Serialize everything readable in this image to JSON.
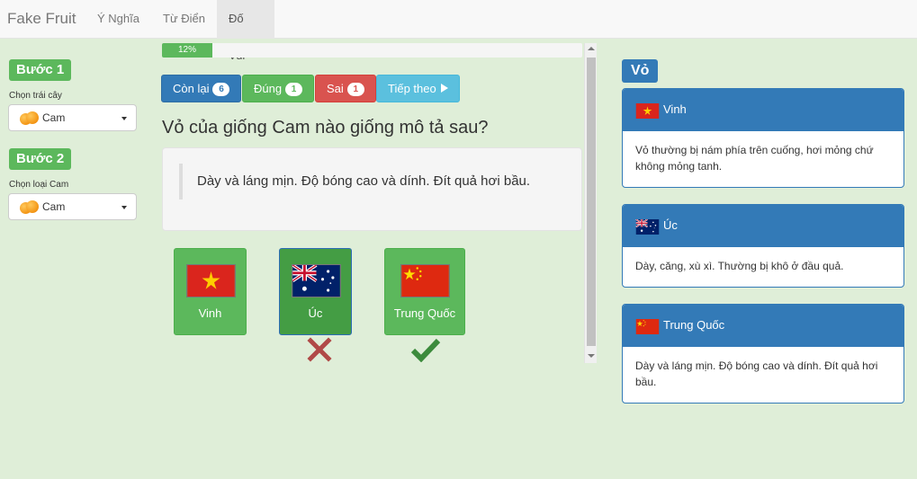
{
  "navbar": {
    "brand": "Fake Fruit",
    "items": [
      {
        "label": "Ý Nghĩa",
        "active": false
      },
      {
        "label": "Từ Điển",
        "active": false
      },
      {
        "label": "Đố Vui",
        "active": true
      }
    ]
  },
  "sidebar": {
    "step1": {
      "title": "Bước 1",
      "label": "Chọn trái cây",
      "value": "Cam",
      "icon": "orange-icon"
    },
    "step2": {
      "title": "Bước 2",
      "label": "Chọn loại Cam",
      "value": "Cam",
      "icon": "orange-icon"
    }
  },
  "quiz": {
    "progress": {
      "percent": 12,
      "label": "12%"
    },
    "buttons": {
      "remaining": {
        "label": "Còn lại",
        "count": "6"
      },
      "correct": {
        "label": "Đúng",
        "count": "1"
      },
      "wrong": {
        "label": "Sai",
        "count": "1"
      },
      "next": {
        "label": "Tiếp theo"
      }
    },
    "question": "Vỏ của giống Cam nào giống mô tả sau?",
    "description": "Dày và láng mịn. Độ bóng cao và dính. Đít quả hơi bầu.",
    "options": [
      {
        "label": "Vinh",
        "flag": "vietnam-flag-icon",
        "selected": false,
        "result": ""
      },
      {
        "label": "Úc",
        "flag": "australia-flag-icon",
        "selected": true,
        "result": "wrong"
      },
      {
        "label": "Trung Quốc",
        "flag": "china-flag-icon",
        "selected": false,
        "result": "correct"
      }
    ]
  },
  "right": {
    "title": "Vỏ",
    "panels": [
      {
        "title": "Vinh",
        "flag": "vietnam-flag-icon",
        "text": "Vỏ thường bị nám phía trên cuống, hơi mỏng chứ không mỏng tanh."
      },
      {
        "title": "Úc",
        "flag": "australia-flag-icon",
        "text": "Dày, căng, xù xì. Thường bị khô ở đầu quả."
      },
      {
        "title": "Trung Quốc",
        "flag": "china-flag-icon",
        "text": "Dày và láng mịn. Độ bóng cao và dính. Đít quả hơi bầu."
      }
    ]
  },
  "colors": {
    "primary": "#337ab7",
    "success": "#5cb85c",
    "danger": "#d9534f",
    "info": "#5bc0de",
    "background": "#dfeed8"
  }
}
